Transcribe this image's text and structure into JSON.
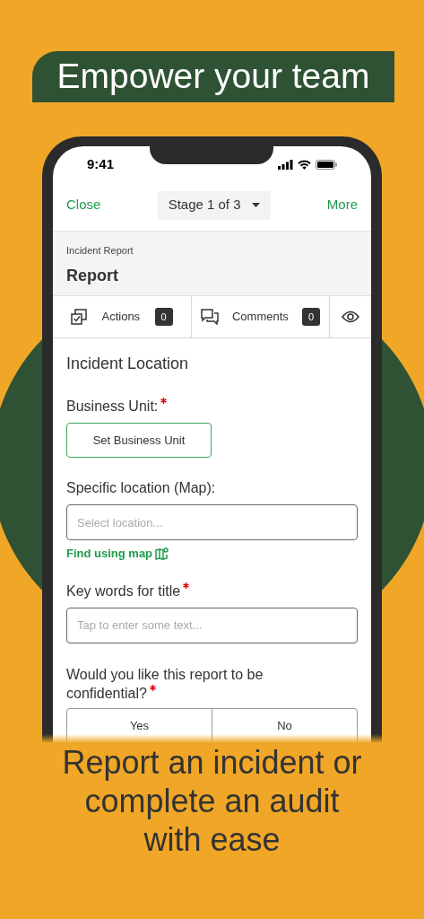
{
  "banner": {
    "title": "Empower your team"
  },
  "status_bar": {
    "time": "9:41"
  },
  "nav": {
    "left": "Close",
    "stage": "Stage 1 of 3",
    "right": "More"
  },
  "header": {
    "subtitle": "Incident Report",
    "title": "Report"
  },
  "tabs": [
    {
      "kind": "actions",
      "label": "Actions",
      "count": "0"
    },
    {
      "kind": "comments",
      "label": "Comments",
      "count": "0"
    },
    {
      "kind": "view"
    }
  ],
  "section_title": "Incident Location",
  "fields": [
    {
      "kind": "button",
      "label": "Business Unit:",
      "required": true,
      "button": "Set Business Unit"
    },
    {
      "kind": "input",
      "label": "Specific location (Map):",
      "required": false,
      "placeholder": "Select location...",
      "link": "Find using map"
    },
    {
      "kind": "input",
      "label": "Key words for title",
      "required": true,
      "placeholder": "Tap to enter some text..."
    },
    {
      "kind": "choice",
      "label": "Would you like this report to be confidential?",
      "required": true,
      "options": [
        "Yes",
        "No"
      ]
    }
  ],
  "tagline": "Report an incident or complete an audit with ease"
}
